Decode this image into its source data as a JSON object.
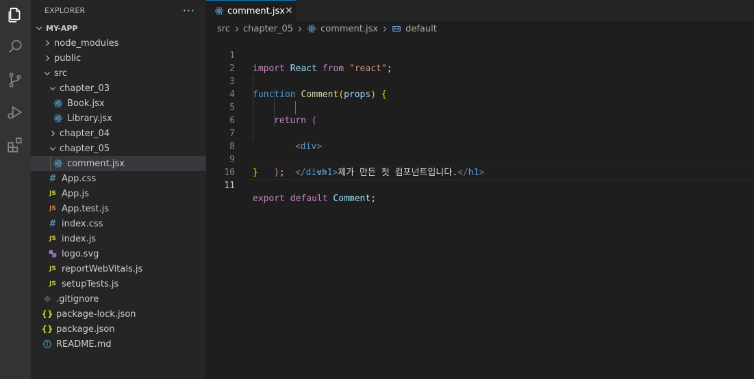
{
  "explorer": {
    "title": "EXPLORER",
    "more": "···",
    "root": "MY-APP",
    "items": [
      {
        "label": "node_modules",
        "icon": "chevron-right"
      },
      {
        "label": "public",
        "icon": "chevron-right"
      },
      {
        "label": "src",
        "icon": "chevron-down"
      },
      {
        "label": "chapter_03",
        "icon": "chevron-down"
      },
      {
        "label": "Book.jsx",
        "icon": "react-icon"
      },
      {
        "label": "Library.jsx",
        "icon": "react-icon"
      },
      {
        "label": "chapter_04",
        "icon": "chevron-right"
      },
      {
        "label": "chapter_05",
        "icon": "chevron-down"
      },
      {
        "label": "comment.jsx",
        "icon": "react-icon"
      },
      {
        "label": "App.css",
        "icon": "#"
      },
      {
        "label": "App.js",
        "icon": "JS"
      },
      {
        "label": "App.test.js",
        "icon": "JS"
      },
      {
        "label": "index.css",
        "icon": "#"
      },
      {
        "label": "index.js",
        "icon": "JS"
      },
      {
        "label": "logo.svg",
        "icon": "svg-icon"
      },
      {
        "label": "reportWebVitals.js",
        "icon": "JS"
      },
      {
        "label": "setupTests.js",
        "icon": "JS"
      },
      {
        "label": ".gitignore",
        "icon": "gitignore-icon"
      },
      {
        "label": "package-lock.json",
        "icon": "{}"
      },
      {
        "label": "package.json",
        "icon": "{}"
      },
      {
        "label": "README.md",
        "icon": "info-icon"
      }
    ]
  },
  "tab": {
    "label": "comment.jsx",
    "close": "✕"
  },
  "breadcrumbs": {
    "src": "src",
    "chapter": "chapter_05",
    "file": "comment.jsx",
    "symbol": "default"
  },
  "editor": {
    "line_numbers": [
      "1",
      "2",
      "3",
      "4",
      "5",
      "6",
      "7",
      "8",
      "9",
      "10",
      "11"
    ],
    "current_line": "11",
    "tokens": {
      "import": "import",
      "react_id": "React",
      "from": "from",
      "react_str": "\"react\"",
      "semi": ";",
      "function": "function",
      "fn_name": "Comment",
      "lparen": "(",
      "props": "props",
      "rparen": ")",
      "lbrace": " {",
      "return": "return",
      "ret_paren": " (",
      "div_open_lt": "<",
      "div_name": "div",
      "div_open_gt": ">",
      "h1_open_lt": "<",
      "h1_name": "h1",
      "h1_open_gt": ">",
      "h1_text": "제가 만든 첫 컴포넌트입니다.",
      "h1_close_lt": "</",
      "h1_close_name": "h1",
      "h1_close_gt": ">",
      "div_close_lt": "</",
      "div_close_name": "div",
      "div_close_gt": ">",
      "close_paren": ")",
      "close_semi": ";",
      "rbrace": "}",
      "export": "export",
      "default": "default",
      "export_id": "Comment",
      "export_semi": ";"
    }
  },
  "colors": {
    "activity_bar": "#333333",
    "sidebar": "#252526",
    "editor": "#1e1e1e",
    "selected_row": "#37373d",
    "keyword": "#c586c0",
    "storage": "#569cd6",
    "string": "#ce9178",
    "function": "#dcdcaa"
  }
}
